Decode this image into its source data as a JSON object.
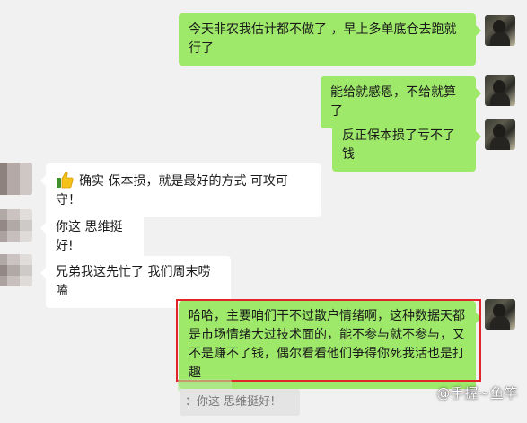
{
  "chat": {
    "messages": [
      {
        "side": "right",
        "text": "今天非农我估计都不做了 ，早上多单底仓去跑就行了"
      },
      {
        "side": "right",
        "text": "能给就感恩，不给就算了"
      },
      {
        "side": "right",
        "text": "反正保本损了亏不了钱"
      },
      {
        "side": "left",
        "icon": "thumbs-up-icon",
        "text": "确实 保本损，就是最好的方式 可攻可守！"
      },
      {
        "side": "left",
        "text": "你这 思维挺好!"
      },
      {
        "side": "left",
        "text": "兄弟我这先忙了 我们周末唠嗑"
      },
      {
        "side": "right",
        "text": "哈哈，主要咱们干不过散户情绪啊，这种数据天都是市场情绪大过技术面的，能不参与就不参与，又不是赚不了钱，偶尔看看他们争得你死我活也是打趣"
      }
    ],
    "quote": "：你这 思维挺好!"
  },
  "watermark": "@手握~鱼竿",
  "colors": {
    "background": "#f1f1f1",
    "outgoing_bubble": "#9ee86a",
    "incoming_bubble": "#ffffff",
    "highlight_border": "#e0262b"
  }
}
